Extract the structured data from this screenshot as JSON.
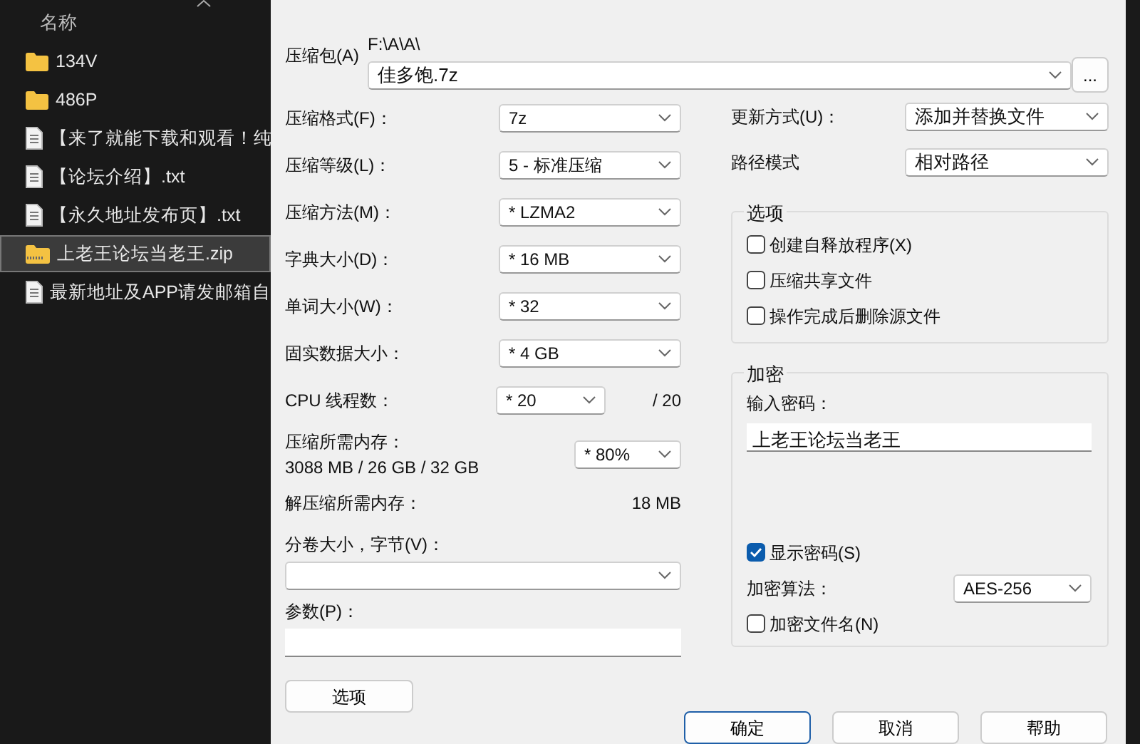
{
  "explorer": {
    "column_header": "名称",
    "items": [
      {
        "name": "134V",
        "kind": "folder",
        "selected": false
      },
      {
        "name": "486P",
        "kind": "folder",
        "selected": false
      },
      {
        "name": "【来了就能下载和观看！纯",
        "kind": "text",
        "selected": false
      },
      {
        "name": "【论坛介绍】.txt",
        "kind": "text",
        "selected": false
      },
      {
        "name": "【永久地址发布页】.txt",
        "kind": "text",
        "selected": false
      },
      {
        "name": "上老王论坛当老王.zip",
        "kind": "archive",
        "selected": true
      },
      {
        "name": "最新地址及APP请发邮箱自",
        "kind": "text",
        "selected": false
      }
    ]
  },
  "dialog": {
    "archive": {
      "label": "压缩包(A)",
      "path": "F:\\A\\A\\",
      "value": "佳多饱.7z"
    },
    "browse_button": "...",
    "left_fields": [
      {
        "kind": "select",
        "label": "压缩格式(F)：",
        "value": "7z"
      },
      {
        "kind": "select",
        "label": "压缩等级(L)：",
        "value": "5 - 标准压缩"
      },
      {
        "kind": "select",
        "label": "压缩方法(M)：",
        "value": "*  LZMA2"
      },
      {
        "kind": "select",
        "label": "字典大小(D)：",
        "value": "*  16 MB"
      },
      {
        "kind": "select",
        "label": "单词大小(W)：",
        "value": "*  32"
      },
      {
        "kind": "select",
        "label": "固实数据大小：",
        "value": "*  4 GB"
      },
      {
        "kind": "threads",
        "label": "CPU 线程数：",
        "value": "*  20",
        "total": "/ 20"
      },
      {
        "kind": "memory",
        "label": "压缩所需内存：",
        "detail": "3088 MB / 26 GB / 32 GB",
        "value": "* 80%"
      },
      {
        "kind": "info",
        "label": "解压缩所需内存：",
        "value": "18 MB"
      },
      {
        "kind": "combo",
        "label": "分卷大小，字节(V)："
      },
      {
        "kind": "input",
        "label": "参数(P)："
      }
    ],
    "options_button": "选项",
    "update_mode": {
      "label": "更新方式(U)：",
      "value": "添加并替换文件"
    },
    "path_mode": {
      "label": "路径模式",
      "value": "相对路径"
    },
    "options_group": {
      "title": "选项",
      "checkboxes": [
        {
          "label": "创建自释放程序(X)",
          "checked": false
        },
        {
          "label": "压缩共享文件",
          "checked": false
        },
        {
          "label": "操作完成后删除源文件",
          "checked": false
        }
      ]
    },
    "encryption": {
      "title": "加密",
      "password_label": "输入密码：",
      "password": "上老王论坛当老王",
      "show_password": {
        "label": "显示密码(S)",
        "checked": true
      },
      "method": {
        "label": "加密算法：",
        "value": "AES-256"
      },
      "encrypt_names": {
        "label": "加密文件名(N)",
        "checked": false
      }
    },
    "buttons": [
      {
        "label": "确定",
        "default": true
      },
      {
        "label": "取消",
        "default": false
      },
      {
        "label": "帮助",
        "default": false
      }
    ]
  }
}
